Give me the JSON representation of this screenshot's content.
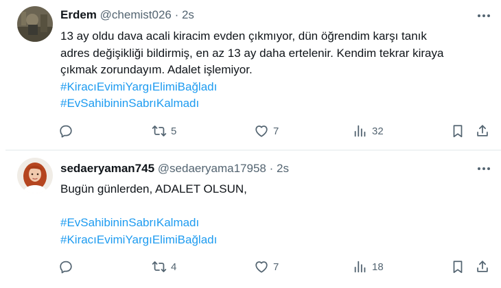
{
  "tweets": [
    {
      "display_name": "Erdem",
      "handle": "@chemist026",
      "time": "2s",
      "lines": [
        "13 ay oldu dava acali kiracim evden çıkmıyor, dün öğrendim karşı tanık",
        "adres değişikliği bildirmiş, en az 13 ay daha ertelenir. Kendim tekrar kiraya",
        "çıkmak zorundayım. Adalet işlemiyor."
      ],
      "hashtags": [
        "#KiracıEvimiYargıElimiBağladı",
        "#EvSahibininSabrıKalmadı"
      ],
      "replies": "",
      "retweets": "5",
      "likes": "7",
      "views": "32"
    },
    {
      "display_name": "sedaeryaman745",
      "handle": "@sedaeryama17958",
      "time": "2s",
      "lines": [
        "Bugün günlerden, ADALET OLSUN,"
      ],
      "hashtags": [
        "#EvSahibininSabrıKalmadı",
        "#KiracıEvimiYargıElimiBağladı"
      ],
      "replies": "",
      "retweets": "4",
      "likes": "7",
      "views": "18"
    }
  ],
  "separator": " · ",
  "colors": {
    "text": "#0f1419",
    "secondary": "#536471",
    "link": "#1d9bf0",
    "divider": "#eff3f4"
  },
  "icons": [
    "more-icon",
    "reply-icon",
    "retweet-icon",
    "like-icon",
    "views-icon",
    "bookmark-icon",
    "share-icon"
  ]
}
